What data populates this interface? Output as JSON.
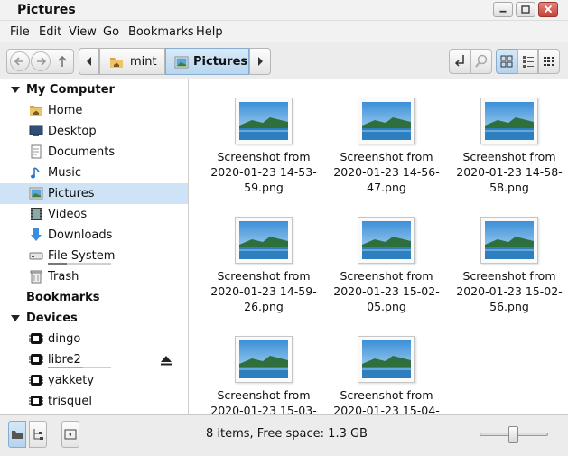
{
  "window": {
    "title": "Pictures"
  },
  "menu": [
    "File",
    "Edit",
    "View",
    "Go",
    "Bookmarks",
    "Help"
  ],
  "breadcrumb": [
    {
      "label": "mint",
      "icon": "home-folder-icon"
    },
    {
      "label": "Pictures",
      "icon": "pictures-folder-icon"
    }
  ],
  "sidebar": {
    "my_computer": "My Computer",
    "places": [
      {
        "label": "Home",
        "icon": "home-folder-icon"
      },
      {
        "label": "Desktop",
        "icon": "desktop-icon"
      },
      {
        "label": "Documents",
        "icon": "documents-icon"
      },
      {
        "label": "Music",
        "icon": "music-icon"
      },
      {
        "label": "Pictures",
        "icon": "pictures-icon",
        "selected": true
      },
      {
        "label": "Videos",
        "icon": "videos-icon"
      },
      {
        "label": "Downloads",
        "icon": "downloads-icon"
      },
      {
        "label": "File System",
        "icon": "drive-icon"
      },
      {
        "label": "Trash",
        "icon": "trash-icon"
      }
    ],
    "bookmarks": "Bookmarks",
    "devices_label": "Devices",
    "devices": [
      {
        "label": "dingo",
        "icon": "chip-icon"
      },
      {
        "label": "libre2",
        "icon": "chip-icon",
        "eject": true
      },
      {
        "label": "yakkety",
        "icon": "chip-icon"
      },
      {
        "label": "trisquel",
        "icon": "chip-icon"
      }
    ]
  },
  "files": [
    "Screenshot from\n2020-01-23 14-53-\n59.png",
    "Screenshot from\n2020-01-23 14-56-\n47.png",
    "Screenshot from\n2020-01-23 14-58-\n58.png",
    "Screenshot from\n2020-01-23 14-59-\n26.png",
    "Screenshot from\n2020-01-23 15-02-\n05.png",
    "Screenshot from\n2020-01-23 15-02-\n56.png",
    "Screenshot from\n2020-01-23 15-03-",
    "Screenshot from\n2020-01-23 15-04-"
  ],
  "status": {
    "text": "8 items, Free space: 1.3 GB"
  },
  "zoom": {
    "level": 0.5
  },
  "colors": {
    "selection": "#cfe3f6",
    "active_crumb": "#b7d6f0",
    "close_button": "#c5433a"
  }
}
